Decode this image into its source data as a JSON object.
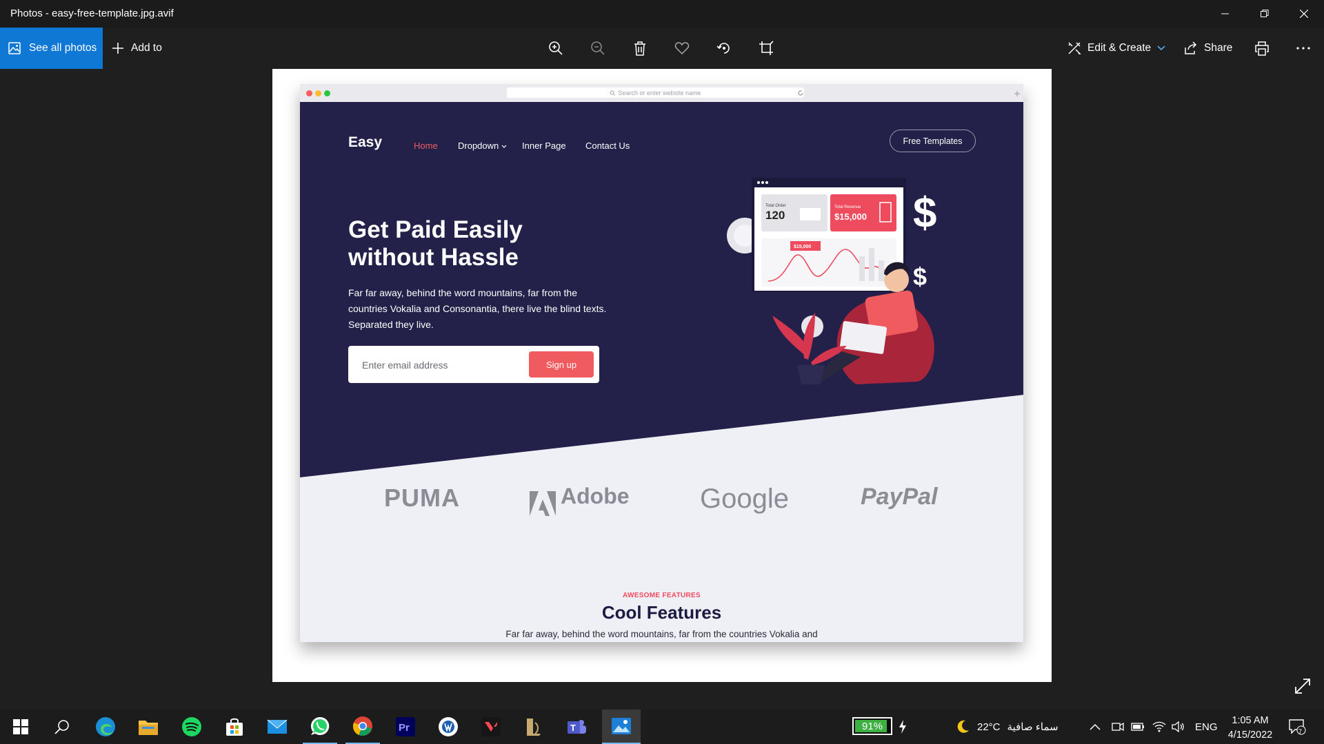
{
  "window": {
    "title": "Photos - easy-free-template.jpg.avif"
  },
  "toolbar": {
    "see_all_label": "See all photos",
    "add_to_label": "Add to",
    "edit_create_label": "Edit & Create",
    "share_label": "Share"
  },
  "browser": {
    "url_placeholder": "Search or enter website name"
  },
  "site": {
    "logo": "Easy",
    "nav": {
      "home": "Home",
      "dropdown": "Dropdown",
      "inner": "Inner Page",
      "contact": "Contact Us"
    },
    "cta": "Free Templates",
    "headline_line1": "Get Paid Easily",
    "headline_line2": "without Hassle",
    "description": "Far far away, behind the word mountains, far from the countries Vokalia and Consonantia, there live the blind texts. Separated they live.",
    "email_placeholder": "Enter email address",
    "signup": "Sign up",
    "dashboard": {
      "total_order_label": "Total Order",
      "total_order_value": "120",
      "total_revenue_label": "Total Revenue",
      "total_revenue_value": "$15,000",
      "chart_tag": "$15,000",
      "dollar_sign": "$"
    },
    "brands": [
      "PUMA",
      "Adobe",
      "Google",
      "PayPal"
    ],
    "features": {
      "kicker": "AWESOME FEATURES",
      "title": "Cool Features",
      "description": "Far far away, behind the word mountains, far from the countries Vokalia and"
    }
  },
  "colors": {
    "accent": "#0f78d4",
    "hero_bg": "#23214a",
    "brand_red": "#ef5b5e",
    "battery_green": "#3cb043"
  },
  "taskbar": {
    "battery_percent": "91%",
    "battery_level": 0.91,
    "weather_temp": "22°C",
    "weather_text": "سماء صافية",
    "language": "ENG",
    "time": "1:05 AM",
    "date": "4/15/2022",
    "notification_count": "7"
  }
}
